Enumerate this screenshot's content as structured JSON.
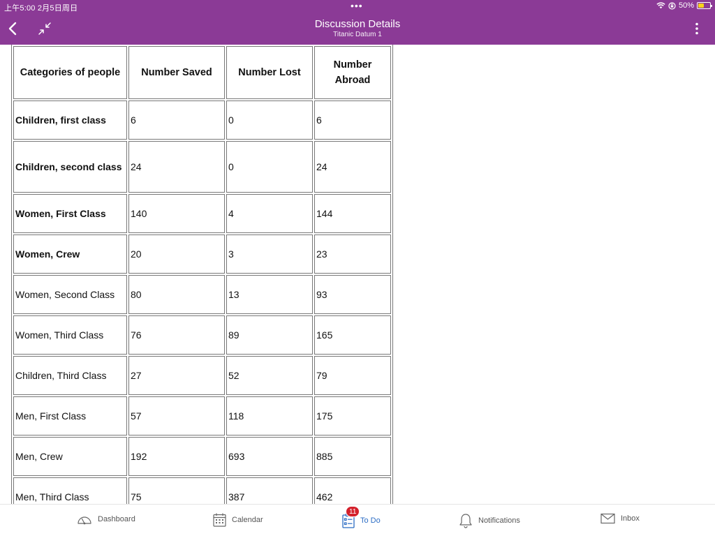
{
  "status_bar": {
    "time_date": "上午5:00  2月5日周日",
    "battery_text": "50%",
    "battery_level": 0.5,
    "battery_color": "#f6d31b",
    "multitask_dots": "•••"
  },
  "header": {
    "title": "Discussion Details",
    "subtitle": "Titanic Datum 1",
    "background_color": "#8b3a96",
    "icons": [
      "chevron-left-icon",
      "collapse-arrows-icon",
      "more-vertical-icon"
    ]
  },
  "table": {
    "headers": [
      "Categories of people",
      "Number Saved",
      "Number Lost",
      "Number Abroad"
    ],
    "rows": [
      {
        "category": "Children, first class",
        "saved": "6",
        "lost": "0",
        "abroad": "6",
        "bold": true
      },
      {
        "category": "Children, second class",
        "saved": "24",
        "lost": "0",
        "abroad": "24",
        "bold": true
      },
      {
        "category": "Women, First Class",
        "saved": "140",
        "lost": "4",
        "abroad": "144",
        "bold": true
      },
      {
        "category": "Women, Crew",
        "saved": "20",
        "lost": "3",
        "abroad": "23",
        "bold": true
      },
      {
        "category": "Women, Second Class",
        "saved": "80",
        "lost": "13",
        "abroad": "93",
        "bold": false
      },
      {
        "category": "Women, Third Class",
        "saved": "76",
        "lost": "89",
        "abroad": "165",
        "bold": false
      },
      {
        "category": "Children, Third Class",
        "saved": "27",
        "lost": "52",
        "abroad": "79",
        "bold": false
      },
      {
        "category": "Men, First Class",
        "saved": "57",
        "lost": "118",
        "abroad": "175",
        "bold": false
      },
      {
        "category": "Men, Crew",
        "saved": "192",
        "lost": "693",
        "abroad": "885",
        "bold": false
      },
      {
        "category": "Men, Third Class",
        "saved": "75",
        "lost": "387",
        "abroad": "462",
        "bold": false
      }
    ]
  },
  "bottom_nav": {
    "items": [
      {
        "label": "Dashboard",
        "icon": "dashboard-gauge-icon",
        "active": false
      },
      {
        "label": "Calendar",
        "icon": "calendar-icon",
        "active": false
      },
      {
        "label": "To Do",
        "icon": "todo-list-icon",
        "active": true,
        "badge": "11"
      },
      {
        "label": "Notifications",
        "icon": "bell-icon",
        "active": false
      },
      {
        "label": "Inbox",
        "icon": "envelope-icon",
        "active": false
      }
    ],
    "active_color": "#2b6cc4",
    "badge_color": "#d4212c"
  }
}
